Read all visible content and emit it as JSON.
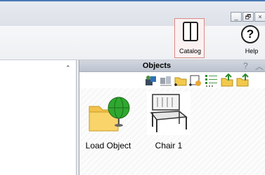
{
  "window_controls": {
    "minimize": "_",
    "maximize": "🗗",
    "close": "×"
  },
  "ribbon": {
    "catalog_label": "Catalog",
    "help_label": "Help"
  },
  "left_pane": {
    "scroll_arrow": "⌃"
  },
  "objects_panel": {
    "title": "Objects",
    "header_help": "?",
    "header_collapse": "︿",
    "items": [
      {
        "label": "Load Object",
        "icon": "folder-globe-icon"
      },
      {
        "label": "Chair 1",
        "icon": "chair-thumbnail"
      }
    ]
  },
  "colors": {
    "accent": "#4a79b4",
    "catalog_border": "#d98a86"
  }
}
